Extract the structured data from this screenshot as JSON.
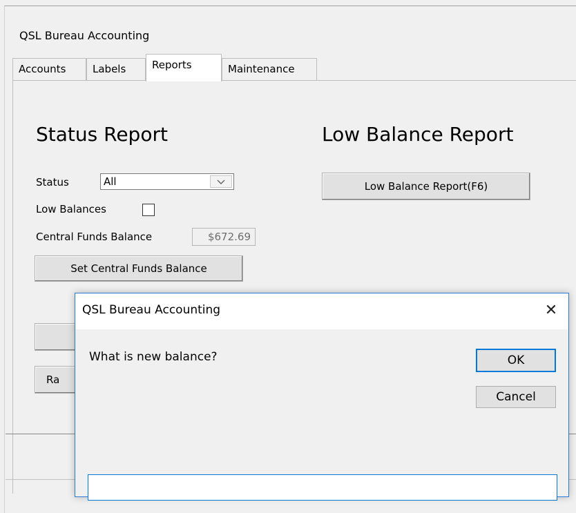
{
  "window": {
    "title": "QSL Bureau Accounting"
  },
  "tabs": [
    {
      "label": "Accounts"
    },
    {
      "label": "Labels"
    },
    {
      "label": "Reports"
    },
    {
      "label": "Maintenance"
    }
  ],
  "active_tab": "Reports",
  "status_report": {
    "heading": "Status Report",
    "status_label": "Status",
    "status_value": "All",
    "low_balances_label": "Low Balances",
    "central_funds_label": "Central Funds Balance",
    "central_funds_value": "$672.69",
    "set_button": "Set Central Funds Balance",
    "partial_button_label": "Ra"
  },
  "low_balance_report": {
    "heading": "Low Balance Report",
    "button": "Low Balance Report(F6)"
  },
  "dialog": {
    "title": "QSL Bureau Accounting",
    "close_glyph": "✕",
    "prompt": "What is new balance?",
    "ok": "OK",
    "cancel": "Cancel",
    "input_value": ""
  },
  "icons": {
    "dropdown_arrow": "chevron-down-icon",
    "close": "close-icon"
  },
  "colors": {
    "accent": "#0078d7",
    "dialog_border": "#2b79d8"
  }
}
